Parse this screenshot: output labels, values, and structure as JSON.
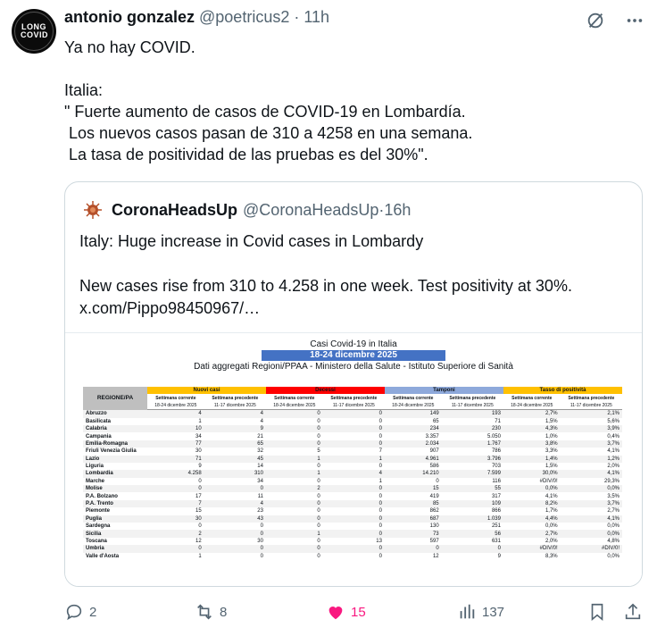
{
  "tweet": {
    "author_name": "antonio gonzalez",
    "handle": "@poetricus2",
    "sep": " · ",
    "time": "11h",
    "text": "Ya no hay COVID.\n\nItalia:\n\" Fuerte aumento de casos de COVID-19 en Lombardía.\n Los nuevos casos pasan de 310 a 4258 en una semana.\n La tasa de positividad de las pruebas es del 30%\".",
    "avatar_text": "LONG COVID"
  },
  "quote": {
    "author_name": "CoronaHeadsUp",
    "handle": "@CoronaHeadsUp",
    "sep": " · ",
    "time": "16h",
    "text": "Italy: Huge increase in Covid cases in Lombardy\n\nNew cases rise from 310 to 4.258 in one week. Test positivity at 30%.\nx.com/Pippo98450967/…"
  },
  "table": {
    "title": "Casi Covid-19 in Italia",
    "date_range": "18-24 dicembre 2025",
    "subtitle": "Dati aggregati Regioni/PPAA - Ministero della Salute - Istituto Superiore di Sanità",
    "region_header": "REGIONE/PA",
    "groups": [
      "Nuovi casi",
      "Decessi",
      "Tamponi",
      "Tasso di positività"
    ],
    "group_colors": [
      "#ffc000",
      "#ff0000",
      "#8ea9db",
      "#ffc000"
    ],
    "current_label": "Settimana corrente",
    "previous_label": "Settimana precedente",
    "current_dates": "18-24 dicembre 2025",
    "previous_dates": "11-17 dicembre 2025",
    "rows": [
      [
        "Abruzzo",
        "4",
        "4",
        "0",
        "0",
        "149",
        "193",
        "2,7%",
        "2,1%"
      ],
      [
        "Basilicata",
        "1",
        "4",
        "0",
        "0",
        "65",
        "71",
        "1,5%",
        "5,6%"
      ],
      [
        "Calabria",
        "10",
        "9",
        "0",
        "0",
        "234",
        "230",
        "4,3%",
        "3,9%"
      ],
      [
        "Campania",
        "34",
        "21",
        "0",
        "0",
        "3.357",
        "5.050",
        "1,0%",
        "0,4%"
      ],
      [
        "Emilia-Romagna",
        "77",
        "65",
        "0",
        "0",
        "2.034",
        "1.767",
        "3,8%",
        "3,7%"
      ],
      [
        "Friuli Venezia Giulia",
        "30",
        "32",
        "5",
        "7",
        "907",
        "786",
        "3,3%",
        "4,1%"
      ],
      [
        "Lazio",
        "71",
        "45",
        "1",
        "1",
        "4.961",
        "3.796",
        "1,4%",
        "1,2%"
      ],
      [
        "Liguria",
        "9",
        "14",
        "0",
        "0",
        "586",
        "703",
        "1,5%",
        "2,0%"
      ],
      [
        "Lombardia",
        "4.258",
        "310",
        "1",
        "4",
        "14.210",
        "7.599",
        "30,0%",
        "4,1%"
      ],
      [
        "Marche",
        "0",
        "34",
        "0",
        "1",
        "0",
        "116",
        "#DIV/0!",
        "29,3%"
      ],
      [
        "Molise",
        "0",
        "0",
        "2",
        "0",
        "15",
        "55",
        "0,0%",
        "0,0%"
      ],
      [
        "P.A. Bolzano",
        "17",
        "11",
        "0",
        "0",
        "419",
        "317",
        "4,1%",
        "3,5%"
      ],
      [
        "P.A. Trento",
        "7",
        "4",
        "0",
        "0",
        "85",
        "109",
        "8,2%",
        "3,7%"
      ],
      [
        "Piemonte",
        "15",
        "23",
        "0",
        "0",
        "862",
        "866",
        "1,7%",
        "2,7%"
      ],
      [
        "Puglia",
        "30",
        "43",
        "0",
        "0",
        "687",
        "1.039",
        "4,4%",
        "4,1%"
      ],
      [
        "Sardegna",
        "0",
        "0",
        "0",
        "0",
        "130",
        "251",
        "0,0%",
        "0,0%"
      ],
      [
        "Sicilia",
        "2",
        "0",
        "1",
        "0",
        "73",
        "56",
        "2,7%",
        "0,0%"
      ],
      [
        "Toscana",
        "12",
        "30",
        "0",
        "13",
        "597",
        "631",
        "2,0%",
        "4,8%"
      ],
      [
        "Umbria",
        "0",
        "0",
        "0",
        "0",
        "0",
        "0",
        "#DIV/0!",
        "#DIV/0!"
      ],
      [
        "Valle d'Aosta",
        "1",
        "0",
        "0",
        "0",
        "12",
        "9",
        "8,3%",
        "0,0%"
      ]
    ]
  },
  "actions": {
    "replies": "2",
    "reposts": "8",
    "likes": "15",
    "views": "137",
    "like_color": "#f91880"
  }
}
